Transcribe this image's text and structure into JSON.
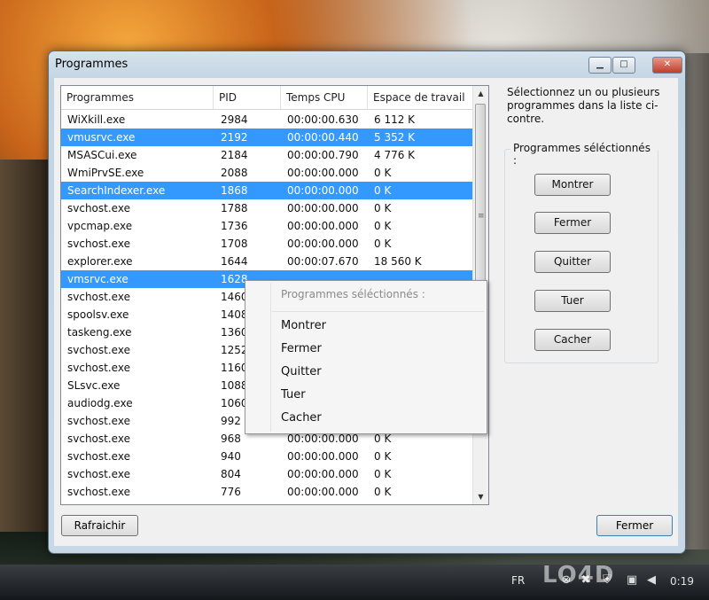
{
  "window": {
    "title": "Programmes"
  },
  "list": {
    "columns": [
      "Programmes",
      "PID",
      "Temps CPU",
      "Espace de travail"
    ],
    "rows": [
      [
        "WiXkill.exe",
        "2984",
        "00:00:00.630",
        "6 112 K"
      ],
      [
        "vmusrvc.exe",
        "2192",
        "00:00:00.440",
        "5 352 K"
      ],
      [
        "MSASCui.exe",
        "2184",
        "00:00:00.790",
        "4 776 K"
      ],
      [
        "WmiPrvSE.exe",
        "2088",
        "00:00:00.000",
        "0 K"
      ],
      [
        "SearchIndexer.exe",
        "1868",
        "00:00:00.000",
        "0 K"
      ],
      [
        "svchost.exe",
        "1788",
        "00:00:00.000",
        "0 K"
      ],
      [
        "vpcmap.exe",
        "1736",
        "00:00:00.000",
        "0 K"
      ],
      [
        "svchost.exe",
        "1708",
        "00:00:00.000",
        "0 K"
      ],
      [
        "explorer.exe",
        "1644",
        "00:00:07.670",
        "18 560 K"
      ],
      [
        "vmsrvc.exe",
        "1628",
        "",
        ""
      ],
      [
        "svchost.exe",
        "1460",
        "",
        ""
      ],
      [
        "spoolsv.exe",
        "1408",
        "",
        ""
      ],
      [
        "taskeng.exe",
        "1360",
        "",
        ""
      ],
      [
        "svchost.exe",
        "1252",
        "",
        ""
      ],
      [
        "svchost.exe",
        "1160",
        "",
        ""
      ],
      [
        "SLsvc.exe",
        "1088",
        "",
        ""
      ],
      [
        "audiodg.exe",
        "1060",
        "",
        ""
      ],
      [
        "svchost.exe",
        "992",
        "",
        ""
      ],
      [
        "svchost.exe",
        "968",
        "00:00:00.000",
        "0 K"
      ],
      [
        "svchost.exe",
        "940",
        "00:00:00.000",
        "0 K"
      ],
      [
        "svchost.exe",
        "804",
        "00:00:00.000",
        "0 K"
      ],
      [
        "svchost.exe",
        "776",
        "00:00:00.000",
        "0 K"
      ]
    ],
    "selected_rows": [
      1,
      4,
      9
    ]
  },
  "panel": {
    "instructions": "Sélectionnez un ou plusieurs programmes dans la liste ci-contre.",
    "group_label": "Programmes séléctionnés :",
    "buttons": [
      "Montrer",
      "Fermer",
      "Quitter",
      "Tuer",
      "Cacher"
    ]
  },
  "footer": {
    "refresh_label": "Rafraichir",
    "close_label": "Fermer"
  },
  "context_menu": {
    "title": "Programmes séléctionnés :",
    "items": [
      "Montrer",
      "Fermer",
      "Quitter",
      "Tuer",
      "Cacher"
    ]
  },
  "taskbar": {
    "language": "FR",
    "clock": "0:19",
    "watermark": "LO4D"
  },
  "colors": {
    "selection": "#3399ff",
    "window_frame": "#c9d8e6",
    "close_button": "#c13d2a"
  }
}
